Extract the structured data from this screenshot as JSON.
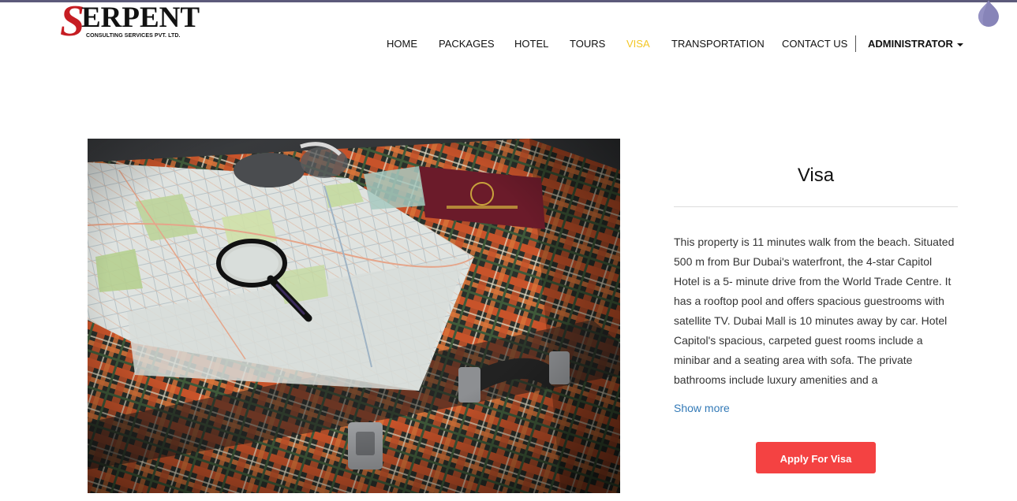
{
  "brand": {
    "initial": "S",
    "name": "ERPENT",
    "tagline": "CONSULTING SERVICES PVT. LTD."
  },
  "nav": {
    "items": [
      {
        "label": "HOME"
      },
      {
        "label": "PACKAGES"
      },
      {
        "label": "HOTEL"
      },
      {
        "label": "TOURS"
      },
      {
        "label": "VISA",
        "active": true
      },
      {
        "label": "TRANSPORTATION"
      },
      {
        "label": "CONTACT US"
      }
    ],
    "account_label": "ADMINISTRATOR",
    "active_color": "#f3c623"
  },
  "photo": {
    "description_icon": "travel-suitcase-map-passport-image"
  },
  "panel": {
    "title": "Visa",
    "description": "This property is 11 minutes walk from the beach. Situated 500 m from Bur Dubai's waterfront, the 4-star Capitol Hotel is a 5- minute drive from the World Trade Centre. It has a rooftop pool and offers spacious guestrooms with satellite TV. Dubai Mall is 10 minutes away by car. Hotel Capitol's spacious, carpeted guest rooms include a minibar and a seating area with sofa. The private bathrooms include luxury amenities and a",
    "show_more": "Show more",
    "apply_button": "Apply For Visa",
    "button_color": "#f44242",
    "link_color": "#337ab7"
  }
}
